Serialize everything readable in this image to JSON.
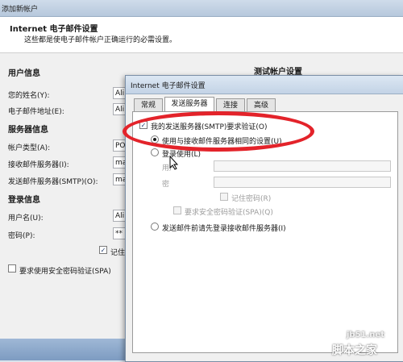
{
  "window": {
    "title": "添加新帐户",
    "header_title": "Internet 电子邮件设置",
    "header_subtitle": "这些都是使电子邮件帐户正确运行的必需设置。"
  },
  "user_info": {
    "section": "用户信息",
    "name_label": "您的姓名(Y):",
    "name_value": "Ali",
    "email_label": "电子邮件地址(E):",
    "email_value": "Ali"
  },
  "server_info": {
    "section": "服务器信息",
    "account_type_label": "帐户类型(A):",
    "account_type_value": "PO",
    "incoming_label": "接收邮件服务器(I):",
    "incoming_value": "ma",
    "outgoing_label": "发送邮件服务器(SMTP)(O):",
    "outgoing_value": "ma"
  },
  "login_info": {
    "section": "登录信息",
    "username_label": "用户名(U):",
    "username_value": "Ali",
    "password_label": "密码(P):",
    "password_value": "**",
    "remember_label": "记住",
    "spa_label": "要求使用安全密码验证(SPA)"
  },
  "test_settings": {
    "title": "测试帐户设置"
  },
  "dialog": {
    "title": "Internet 电子邮件设置",
    "tabs": [
      "常规",
      "发送服务器",
      "连接",
      "高级"
    ],
    "smtp_auth_label": "我的发送服务器(SMTP)要求验证(O)",
    "same_settings_label": "使用与接收邮件服务器相同的设置(U)",
    "login_using_label": "登录使用(L)",
    "user_label": "用户",
    "password_label": "密",
    "remember_pwd_label": "记住密码(R)",
    "spa_label": "要求安全密码验证(SPA)(Q)",
    "login_before_send_label": "发送邮件前请先登录接收邮件服务器(I)"
  },
  "watermark": {
    "line1": "jb51.net",
    "line2": "脚本之家"
  },
  "colors": {
    "highlight": "#e3232a",
    "title_bar": "#c3d3e6"
  }
}
